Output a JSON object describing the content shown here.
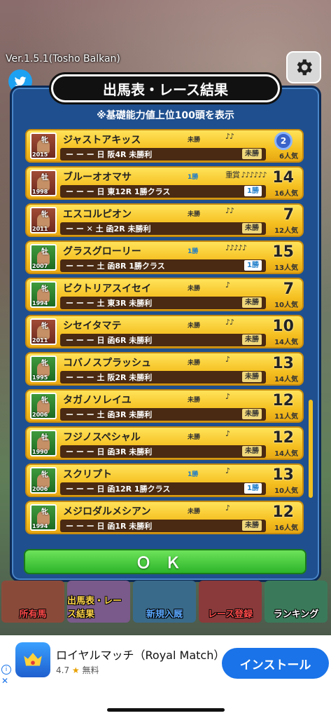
{
  "version": "Ver.1.5.1(Tosho Balkan)",
  "title": "出馬表・レース結果",
  "subtitle": "※基礎能力値上位100頭を表示",
  "ok_label": "ＯＫ",
  "rows": [
    {
      "name": "ジャストアキッス",
      "sex": "牝",
      "year": "2015",
      "thumb": "brown",
      "class": "未勝",
      "class_color": "dark",
      "stars": "♪♪",
      "detail": "ー ー ー  日  阪4R    未勝利",
      "result": "未勝",
      "result_color": "dark",
      "rank": "2",
      "medal": true,
      "pop": "6人気"
    },
    {
      "name": "ブルーオオマサ",
      "sex": "牡",
      "year": "1998",
      "thumb": "brown",
      "class": "1勝",
      "class_color": "blue",
      "stars": "重賞 ♪♪♪♪♪♪",
      "detail": "ー ー ー  日  東12R  1勝クラス",
      "result": "1勝",
      "result_color": "blue",
      "rank": "14",
      "medal": false,
      "pop": "16人気"
    },
    {
      "name": "エスコルピオン",
      "sex": "牝",
      "year": "2011",
      "thumb": "brown",
      "class": "未勝",
      "class_color": "dark",
      "stars": "♪♪",
      "detail": "ー ー ✕  土  函2R    未勝利",
      "result": "未勝",
      "result_color": "dark",
      "rank": "7",
      "medal": false,
      "pop": "12人気"
    },
    {
      "name": "グラスグローリー",
      "sex": "牡",
      "year": "2007",
      "thumb": "green",
      "class": "1勝",
      "class_color": "blue",
      "stars": "♪♪♪♪♪",
      "detail": "ー ー ー  土  函8R   1勝クラス",
      "result": "1勝",
      "result_color": "blue",
      "rank": "15",
      "medal": false,
      "pop": "13人気"
    },
    {
      "name": "ビクトリアスイセイ",
      "sex": "牝",
      "year": "1994",
      "thumb": "green",
      "class": "未勝",
      "class_color": "dark",
      "stars": "♪",
      "detail": "ー ー ー  土  東3R    未勝利",
      "result": "未勝",
      "result_color": "dark",
      "rank": "7",
      "medal": false,
      "pop": "10人気"
    },
    {
      "name": "シセイタマテ",
      "sex": "牝",
      "year": "2011",
      "thumb": "brown",
      "class": "未勝",
      "class_color": "dark",
      "stars": "♪♪",
      "detail": "ー ー ー  日  函6R    未勝利",
      "result": "未勝",
      "result_color": "dark",
      "rank": "10",
      "medal": false,
      "pop": "14人気"
    },
    {
      "name": "コバノスプラッシュ",
      "sex": "牝",
      "year": "1995",
      "thumb": "green",
      "class": "未勝",
      "class_color": "dark",
      "stars": "♪",
      "detail": "ー ー ー  土  阪2R    未勝利",
      "result": "未勝",
      "result_color": "dark",
      "rank": "13",
      "medal": false,
      "pop": "14人気"
    },
    {
      "name": "タガノソレイユ",
      "sex": "牝",
      "year": "2006",
      "thumb": "green",
      "class": "未勝",
      "class_color": "dark",
      "stars": "♪",
      "detail": "ー ー ー  土  函3R    未勝利",
      "result": "未勝",
      "result_color": "dark",
      "rank": "12",
      "medal": false,
      "pop": "11人気"
    },
    {
      "name": "フジノスペシャル",
      "sex": "牡",
      "year": "1990",
      "thumb": "green",
      "class": "未勝",
      "class_color": "dark",
      "stars": "♪",
      "detail": "ー ー ー  日  函3R    未勝利",
      "result": "未勝",
      "result_color": "dark",
      "rank": "12",
      "medal": false,
      "pop": "14人気"
    },
    {
      "name": "スクリプト",
      "sex": "牝",
      "year": "2006",
      "thumb": "green",
      "class": "1勝",
      "class_color": "blue",
      "stars": "♪",
      "detail": "ー ー ー  日  函12R  1勝クラス",
      "result": "1勝",
      "result_color": "blue",
      "rank": "13",
      "medal": false,
      "pop": "10人気"
    },
    {
      "name": "メジロダルメシアン",
      "sex": "牝",
      "year": "1994",
      "thumb": "green",
      "class": "未勝",
      "class_color": "dark",
      "stars": "♪",
      "detail": "ー ー ー  日  函1R    未勝利",
      "result": "未勝",
      "result_color": "dark",
      "rank": "12",
      "medal": false,
      "pop": "16人気"
    }
  ],
  "nav": [
    {
      "label": "所有馬",
      "cls": "n1"
    },
    {
      "label": "出馬表・レース結果",
      "cls": "n2"
    },
    {
      "label": "新規入厩",
      "cls": "n3"
    },
    {
      "label": "レース登録",
      "cls": "n4"
    },
    {
      "label": "ランキング",
      "cls": "n5"
    }
  ],
  "ad": {
    "title": "ロイヤルマッチ（Royal Match）",
    "rating": "4.7",
    "rating_star": "★",
    "price": "無料",
    "install_label": "インストール",
    "info_icon": "i",
    "close_icon": "✕"
  }
}
